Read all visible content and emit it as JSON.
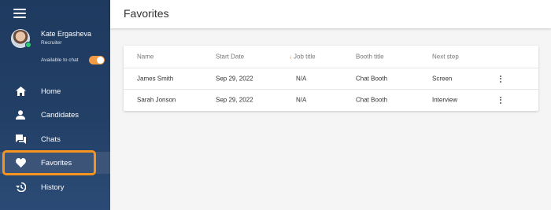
{
  "user": {
    "name": "Kate Ergasheva",
    "role": "Recruiter",
    "chat_status_label": "Available to chat",
    "chat_available": true
  },
  "nav": {
    "items": [
      {
        "label": "Home",
        "icon": "home-icon"
      },
      {
        "label": "Candidates",
        "icon": "person-icon"
      },
      {
        "label": "Chats",
        "icon": "chat-icon"
      },
      {
        "label": "Favorites",
        "icon": "heart-icon",
        "active": true
      },
      {
        "label": "History",
        "icon": "history-icon"
      }
    ]
  },
  "page": {
    "title": "Favorites"
  },
  "table": {
    "columns": [
      "Name",
      "Start Date",
      "Job title",
      "Booth title",
      "Next step"
    ],
    "sort_column": "Job title",
    "rows": [
      {
        "name": "James Smith",
        "start_date": "Sep 29, 2022",
        "job_title": "N/A",
        "booth_title": "Chat Booth",
        "next_step": "Screen"
      },
      {
        "name": "Sarah Jonson",
        "start_date": "Sep 29, 2022",
        "job_title": "N/A",
        "booth_title": "Chat Booth",
        "next_step": "Interview"
      }
    ]
  },
  "colors": {
    "sidebar": "#1f3a5f",
    "accent": "#f39a45",
    "highlight": "#f7941d",
    "online": "#2ecc71"
  }
}
